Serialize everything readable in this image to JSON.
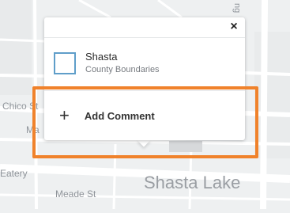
{
  "map": {
    "labels": {
      "chico_st": "Chico St",
      "partial_ma": "Ma",
      "eatery": "Eatery",
      "meade_st": "Meade St",
      "city": "Shasta Lake",
      "vertical_road": "ng"
    }
  },
  "popup": {
    "close_label": "×",
    "layer": {
      "name": "Shasta",
      "subtitle": "County Boundaries",
      "swatch_color": "#5f9ec9"
    },
    "action": {
      "icon": "plus-icon",
      "label": "Add Comment"
    }
  },
  "highlight_color": "#f0822b"
}
